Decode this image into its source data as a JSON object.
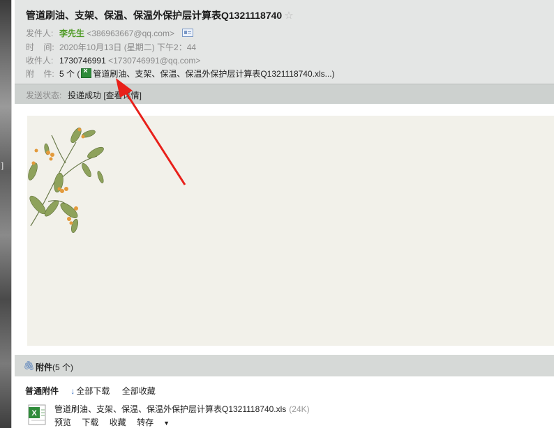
{
  "email": {
    "subject": "管道刷油、支架、保温、保温外保护层计算表Q1321118740",
    "from_label": "发件人:",
    "from_name": "李先生",
    "from_addr": "<386963667@qq.com>",
    "time_label": "时    间:",
    "time_value": "2020年10月13日 (星期二) 下午2：44",
    "to_label": "收件人:",
    "to_name": "1730746991",
    "to_addr": "<1730746991@qq.com>",
    "att_label": "附    件:",
    "att_count": "5 个 (",
    "att_first": "管道刷油、支架、保温、保温外保护层计算表Q1321118740.xls...)",
    "status_label": "发送状态:",
    "status_value": "投递成功 [查看详情]"
  },
  "left_strip": {
    "mark": "]"
  },
  "attachments": {
    "header_title": "附件",
    "header_count": "(5 个)",
    "normal_label": "普通附件",
    "download_all": "全部下载",
    "save_all": "全部收藏",
    "item": {
      "name": "管道刷油、支架、保温、保温外保护层计算表Q1321118740.xls",
      "size": "(24K)",
      "preview": "预览",
      "download": "下载",
      "save": "收藏",
      "forward": "转存"
    }
  },
  "colors": {
    "header_bg": "#e4e6e5",
    "status_bg": "#cdd1cf",
    "letter_bg": "#f2f1ea",
    "sender_green": "#4d9a23",
    "arrow_red": "#e8201a"
  }
}
